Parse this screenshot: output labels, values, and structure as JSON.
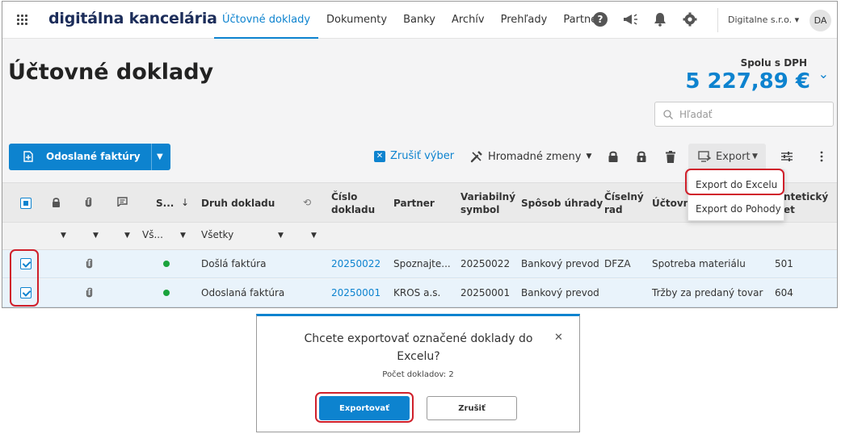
{
  "brand": "digitálna kancelária",
  "nav": [
    {
      "label": "Účtovné doklady",
      "active": true
    },
    {
      "label": "Dokumenty"
    },
    {
      "label": "Banky"
    },
    {
      "label": "Archív"
    },
    {
      "label": "Prehľady"
    },
    {
      "label": "Partneri"
    }
  ],
  "top_icons": [
    "help-icon",
    "megaphone-icon",
    "bell-icon",
    "gear-icon"
  ],
  "user": {
    "company": "Digitalne s.r.o. ▾",
    "initials": "DA"
  },
  "page": {
    "title": "Účtovné doklady"
  },
  "total": {
    "label": "Spolu s DPH",
    "value": "5 227,89 €"
  },
  "search": {
    "placeholder": "Hľadať"
  },
  "toolbar": {
    "doc_type_button": "Odoslané faktúry",
    "clear_selection": "Zrušiť výber",
    "bulk_changes": "Hromadné zmeny",
    "export": "Export"
  },
  "export_menu": [
    "Export do Excelu",
    "Export do Pohody"
  ],
  "columns": {
    "status": "S...",
    "doc_type": "Druh dokladu",
    "doc_number": "Číslo dokladu",
    "partner": "Partner",
    "variable_symbol": "Variabilný symbol",
    "payment": "Spôsob úhrady",
    "series": "Číselný rad",
    "account": "Účtovný",
    "synthetic": "ntetický et"
  },
  "filters": {
    "status": "Vš...",
    "doc_type": "Všetky"
  },
  "rows": [
    {
      "checked": true,
      "doc_type": "Došlá faktúra",
      "number": "20250022",
      "partner": "Spoznajte...",
      "vs": "20250022",
      "payment": "Bankový prevod",
      "series": "DFZA",
      "account": "Spotreba materiálu",
      "synthetic": "501"
    },
    {
      "checked": true,
      "doc_type": "Odoslaná faktúra",
      "number": "20250001",
      "partner": "KROS a.s.",
      "vs": "20250001",
      "payment": "Bankový prevod",
      "series": "",
      "account": "Tržby za predaný tovar",
      "synthetic": "604"
    }
  ],
  "dialog": {
    "title": "Chcete exportovať označené doklady do Excelu?",
    "count": "Počet dokladov: 2",
    "confirm": "Exportovať",
    "cancel": "Zrušiť"
  },
  "colors": {
    "accent": "#0d83cf",
    "highlight": "#d0202b",
    "status_ok": "#1aa33c"
  }
}
